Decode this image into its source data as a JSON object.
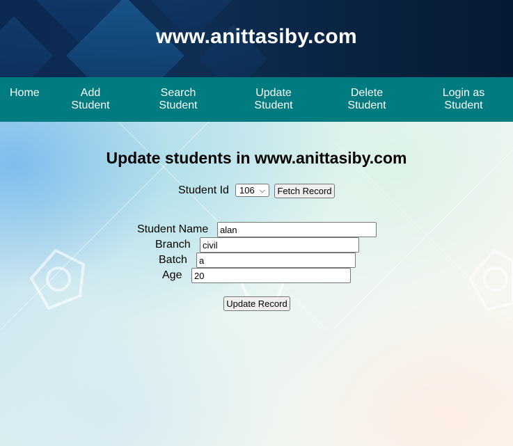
{
  "header": {
    "site_title": "www.anittasiby.com"
  },
  "nav": {
    "items": [
      {
        "label": "Home"
      },
      {
        "label": "Add\nStudent"
      },
      {
        "label": "Search\nStudent"
      },
      {
        "label": "Update\nStudent"
      },
      {
        "label": "Delete\nStudent"
      },
      {
        "label": "Login as\nStudent"
      }
    ]
  },
  "form": {
    "title": "Update students in www.anittasiby.com",
    "student_id": {
      "label": "Student Id",
      "selected": "106"
    },
    "fetch_button": "Fetch Record",
    "fields": {
      "name": {
        "label": "Student Name",
        "value": "alan"
      },
      "branch": {
        "label": "Branch",
        "value": "civil"
      },
      "batch": {
        "label": "Batch",
        "value": "a"
      },
      "age": {
        "label": "Age",
        "value": "20"
      }
    },
    "update_button": "Update Record"
  },
  "colors": {
    "header_bg": "#0b2850",
    "nav_bg": "#007c80",
    "nav_text": "#ffffff"
  }
}
